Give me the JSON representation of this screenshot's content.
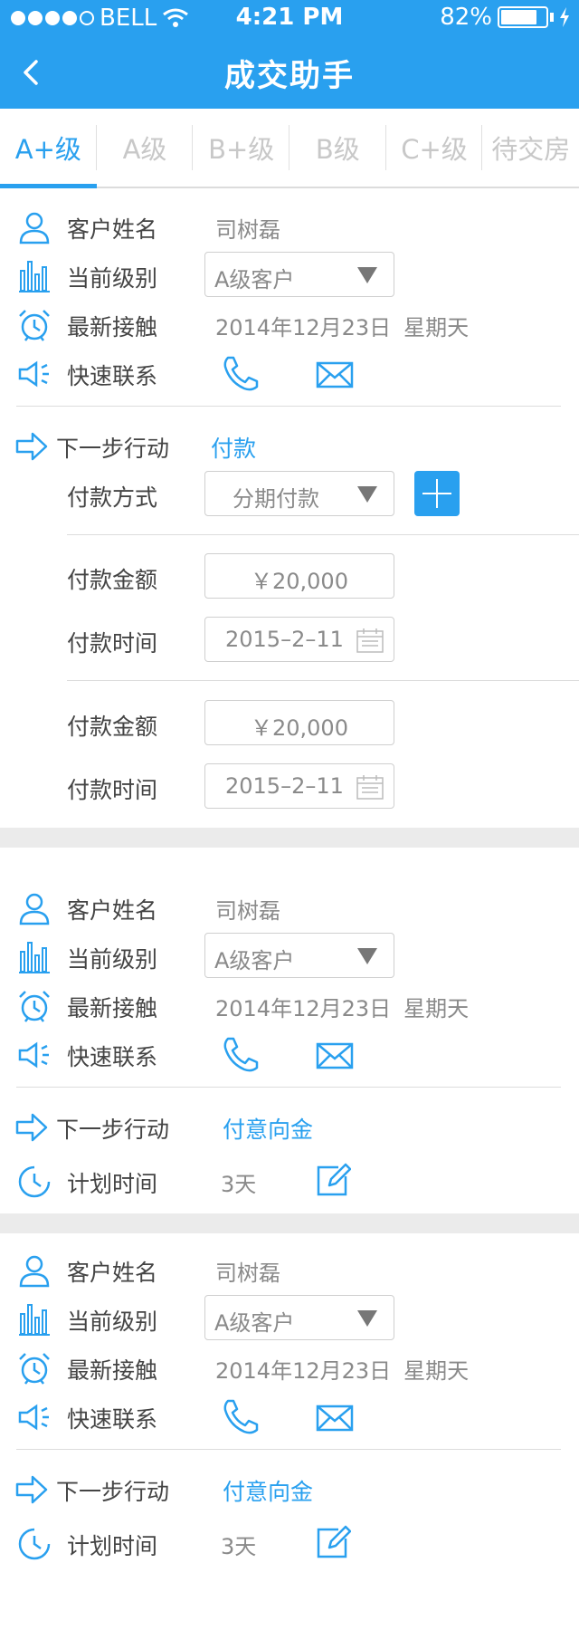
{
  "status_bar": {
    "carrier": "BELL",
    "time": "4:21 PM",
    "battery": "82%",
    "battery_level": 0.82
  },
  "nav": {
    "title": "成交助手"
  },
  "tabs": [
    {
      "label": "A+级",
      "active": true
    },
    {
      "label": "A级",
      "active": false
    },
    {
      "label": "B+级",
      "active": false
    },
    {
      "label": "B级",
      "active": false
    },
    {
      "label": "C+级",
      "active": false
    },
    {
      "label": "待交房",
      "active": false
    }
  ],
  "cards": [
    {
      "customer_name_label": "客户姓名",
      "customer_name": "司树磊",
      "level_label": "当前级别",
      "level_value": "A级客户",
      "contact_label": "最新接触",
      "contact_date": "2014年12月23日",
      "contact_weekday": "星期天",
      "quick_contact_label": "快速联系",
      "next_action_label": "下一步行动",
      "next_action_value": "付款",
      "payment_method_label": "付款方式",
      "payment_method_value": "分期付款",
      "payments": [
        {
          "amount_label": "付款金额",
          "amount": "￥20,000",
          "time_label": "付款时间",
          "time": "2015–2–11"
        },
        {
          "amount_label": "付款金额",
          "amount": "￥20,000",
          "time_label": "付款时间",
          "time": "2015–2–11"
        }
      ]
    },
    {
      "customer_name_label": "客户姓名",
      "customer_name": "司树磊",
      "level_label": "当前级别",
      "level_value": "A级客户",
      "contact_label": "最新接触",
      "contact_date": "2014年12月23日",
      "contact_weekday": "星期天",
      "quick_contact_label": "快速联系",
      "next_action_label": "下一步行动",
      "next_action_value": "付意向金",
      "plan_time_label": "计划时间",
      "plan_time_value": "3天"
    },
    {
      "customer_name_label": "客户姓名",
      "customer_name": "司树磊",
      "level_label": "当前级别",
      "level_value": "A级客户",
      "contact_label": "最新接触",
      "contact_date": "2014年12月23日",
      "contact_weekday": "星期天",
      "quick_contact_label": "快速联系",
      "next_action_label": "下一步行动",
      "next_action_value": "付意向金",
      "plan_time_label": "计划时间",
      "plan_time_value": "3天"
    }
  ],
  "colors": {
    "accent": "#29a0ef",
    "label": "#444444",
    "value": "#8a8a8a",
    "gap": "#ebebeb"
  }
}
